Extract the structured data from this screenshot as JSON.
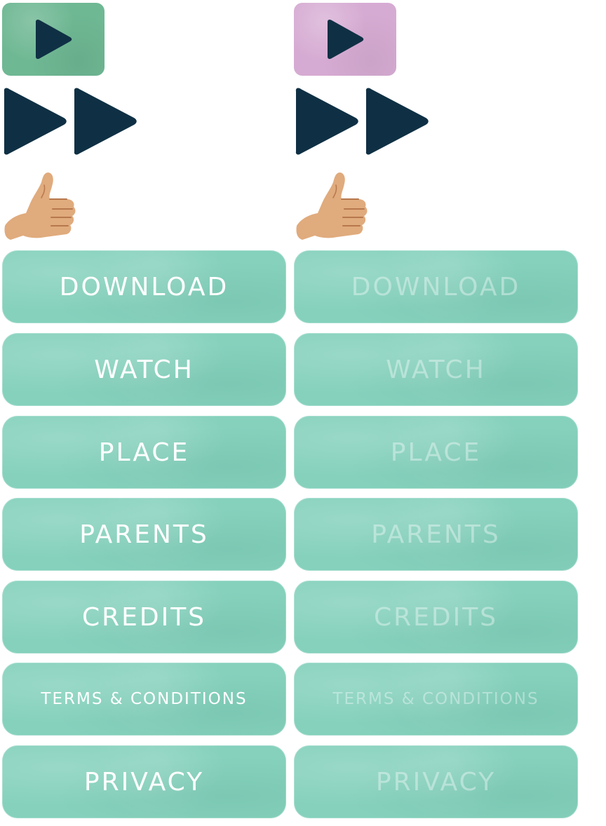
{
  "colors": {
    "button_fill": "#85d1bc",
    "play_tile_green": "#6fb894",
    "play_tile_pink": "#d6abd3",
    "icon_dark": "#0f3044",
    "label_active": "#ffffff",
    "label_disabled": "rgba(255,255,255,0.38)"
  },
  "icons": {
    "play": "play-icon",
    "fast_forward": "fast-forward-icon",
    "thumb": "thumbs-up-icon"
  },
  "left": {
    "state": "normal",
    "buttons": [
      {
        "label": "DOWNLOAD"
      },
      {
        "label": "WATCH"
      },
      {
        "label": "PLACE"
      },
      {
        "label": "PARENTS"
      },
      {
        "label": "CREDITS"
      },
      {
        "label": "TERMS & CONDITIONS"
      },
      {
        "label": "PRIVACY"
      }
    ]
  },
  "right": {
    "state": "pressed",
    "buttons": [
      {
        "label": "DOWNLOAD"
      },
      {
        "label": "WATCH"
      },
      {
        "label": "PLACE"
      },
      {
        "label": "PARENTS"
      },
      {
        "label": "CREDITS"
      },
      {
        "label": "TERMS & CONDITIONS"
      },
      {
        "label": "PRIVACY"
      }
    ]
  }
}
